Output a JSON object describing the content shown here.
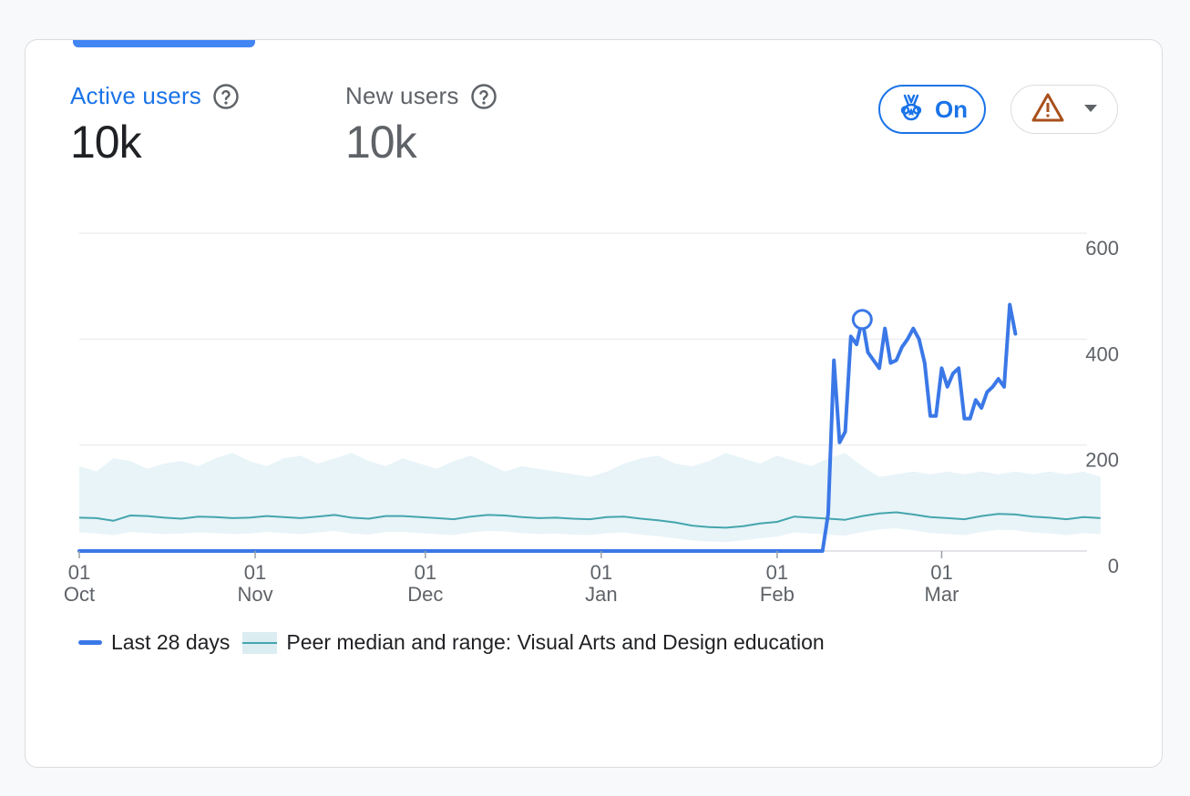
{
  "metrics": [
    {
      "label": "Active users",
      "value": "10k"
    },
    {
      "label": "New users",
      "value": "10k"
    }
  ],
  "benchmark_toggle": {
    "label": "On"
  },
  "colors": {
    "primary": "#1a73e8",
    "series_line": "#3b78e7",
    "peer_line": "#45a5ad",
    "peer_band": "#e8f4f8",
    "warning": "#a8501c"
  },
  "icons": {
    "help": "help-circle-icon",
    "benchmark": "medal-icon",
    "warning": "warning-triangle-icon",
    "dropdown": "caret-down-icon"
  },
  "chart_data": {
    "type": "line",
    "ylim": [
      0,
      600
    ],
    "yticks": [
      0,
      200,
      400,
      600
    ],
    "grid": true,
    "x_start": "2023-10-01",
    "x_end": "2024-03-21",
    "xticks": [
      {
        "date": "2023-10-01",
        "day": "01",
        "month": "Oct"
      },
      {
        "date": "2023-11-01",
        "day": "01",
        "month": "Nov"
      },
      {
        "date": "2023-12-01",
        "day": "01",
        "month": "Dec"
      },
      {
        "date": "2024-01-01",
        "day": "01",
        "month": "Jan"
      },
      {
        "date": "2024-02-01",
        "day": "01",
        "month": "Feb"
      },
      {
        "date": "2024-03-01",
        "day": "01",
        "month": "Mar"
      }
    ],
    "legend_position": "bottom-left",
    "highlight_point": {
      "date": "2024-02-16",
      "value": 437
    },
    "series": [
      {
        "name": "Last 28 days",
        "color": "#3b78e7",
        "points": [
          [
            "2023-10-01",
            0
          ],
          [
            "2024-02-09",
            0
          ],
          [
            "2024-02-10",
            70
          ],
          [
            "2024-02-11",
            360
          ],
          [
            "2024-02-12",
            205
          ],
          [
            "2024-02-13",
            225
          ],
          [
            "2024-02-14",
            405
          ],
          [
            "2024-02-15",
            390
          ],
          [
            "2024-02-16",
            437
          ],
          [
            "2024-02-17",
            375
          ],
          [
            "2024-02-18",
            360
          ],
          [
            "2024-02-19",
            345
          ],
          [
            "2024-02-20",
            420
          ],
          [
            "2024-02-21",
            355
          ],
          [
            "2024-02-22",
            360
          ],
          [
            "2024-02-23",
            385
          ],
          [
            "2024-02-24",
            400
          ],
          [
            "2024-02-25",
            420
          ],
          [
            "2024-02-26",
            400
          ],
          [
            "2024-02-27",
            355
          ],
          [
            "2024-02-28",
            255
          ],
          [
            "2024-02-29",
            255
          ],
          [
            "2024-03-01",
            345
          ],
          [
            "2024-03-02",
            310
          ],
          [
            "2024-03-03",
            335
          ],
          [
            "2024-03-04",
            345
          ],
          [
            "2024-03-05",
            250
          ],
          [
            "2024-03-06",
            250
          ],
          [
            "2024-03-07",
            285
          ],
          [
            "2024-03-08",
            270
          ],
          [
            "2024-03-09",
            300
          ],
          [
            "2024-03-10",
            310
          ],
          [
            "2024-03-11",
            325
          ],
          [
            "2024-03-12",
            310
          ],
          [
            "2024-03-13",
            465
          ],
          [
            "2024-03-14",
            410
          ]
        ]
      },
      {
        "name": "Peer median and range: Visual Arts and Design education",
        "color": "#45a5ad",
        "band_color": "#e8f4f8",
        "start": "2023-10-01",
        "step_days": 3,
        "median": [
          63,
          62,
          57,
          67,
          66,
          63,
          61,
          65,
          64,
          62,
          63,
          66,
          64,
          62,
          65,
          68,
          63,
          61,
          66,
          66,
          64,
          62,
          60,
          65,
          68,
          67,
          64,
          62,
          63,
          61,
          60,
          64,
          65,
          61,
          58,
          54,
          48,
          45,
          44,
          47,
          52,
          55,
          65,
          63,
          61,
          59,
          66,
          71,
          73,
          69,
          64,
          62,
          60,
          66,
          70,
          69,
          65,
          63,
          60,
          64,
          62
        ],
        "upper": [
          160,
          150,
          175,
          170,
          155,
          165,
          170,
          160,
          175,
          185,
          170,
          160,
          175,
          180,
          165,
          175,
          185,
          170,
          160,
          175,
          165,
          155,
          170,
          180,
          165,
          150,
          160,
          155,
          150,
          145,
          140,
          150,
          165,
          175,
          180,
          165,
          160,
          170,
          185,
          175,
          165,
          180,
          170,
          160,
          175,
          185,
          160,
          140,
          145,
          150,
          145,
          150,
          145,
          150,
          145,
          150,
          145,
          150,
          145,
          150,
          140
        ],
        "lower": [
          35,
          33,
          30,
          36,
          34,
          32,
          33,
          35,
          34,
          32,
          33,
          36,
          34,
          32,
          35,
          38,
          33,
          31,
          36,
          36,
          34,
          32,
          30,
          35,
          38,
          37,
          34,
          32,
          33,
          31,
          30,
          34,
          35,
          31,
          28,
          24,
          20,
          18,
          17,
          20,
          24,
          27,
          35,
          33,
          31,
          29,
          36,
          41,
          43,
          39,
          34,
          32,
          30,
          36,
          40,
          39,
          35,
          33,
          30,
          34,
          32
        ]
      }
    ]
  }
}
